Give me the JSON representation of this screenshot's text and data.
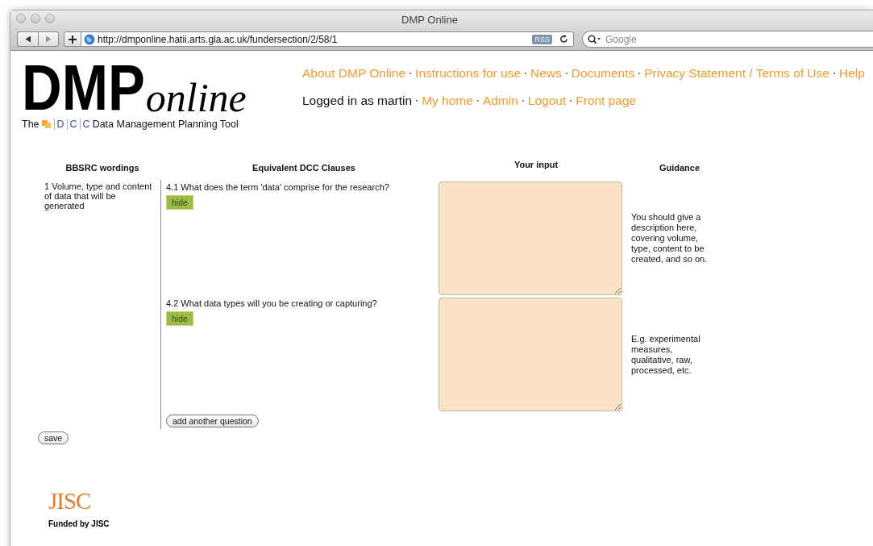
{
  "window": {
    "title": "DMP Online"
  },
  "toolbar": {
    "url": "http://dmponline.hatii.arts.gla.ac.uk/fundersection/2/58/1",
    "feed_badge": "RSS",
    "search": {
      "placeholder": "Google"
    }
  },
  "logo": {
    "main": "DMP",
    "script": "online",
    "tagline_prefix": "The",
    "dcc_letters": [
      "D",
      "C",
      "C"
    ],
    "tagline_suffix": "Data Management Planning Tool"
  },
  "nav": [
    {
      "label": "About DMP Online"
    },
    {
      "label": "Instructions for use"
    },
    {
      "label": "News"
    },
    {
      "label": "Documents"
    },
    {
      "label": "Privacy Statement / Terms of Use"
    },
    {
      "label": "Help"
    }
  ],
  "user_nav": {
    "logged_in": "Logged in as martin",
    "links": [
      {
        "label": "My home"
      },
      {
        "label": "Admin"
      },
      {
        "label": "Logout"
      },
      {
        "label": "Front page"
      }
    ]
  },
  "table": {
    "columns": [
      "BBSRC wordings",
      "Equivalent DCC Clauses",
      "Your input",
      "Guidance"
    ],
    "sections": [
      {
        "wording": "1 Volume, type and content of data that will be generated",
        "clauses": [
          {
            "question": "4.1 What does the term 'data' comprise for the research?",
            "toggle": "hide",
            "guidance": "You should give a description here, covering volume, type, content to be created, and so on."
          },
          {
            "question": "4.2 What data types will you be creating or capturing?",
            "toggle": "hide",
            "guidance": "E.g. experimental measures, qualitative, raw, processed, etc."
          }
        ],
        "add_button": "add another question"
      }
    ]
  },
  "save_button": "save",
  "footer": {
    "logo": "JISC",
    "funded": "Funded by JISC"
  }
}
